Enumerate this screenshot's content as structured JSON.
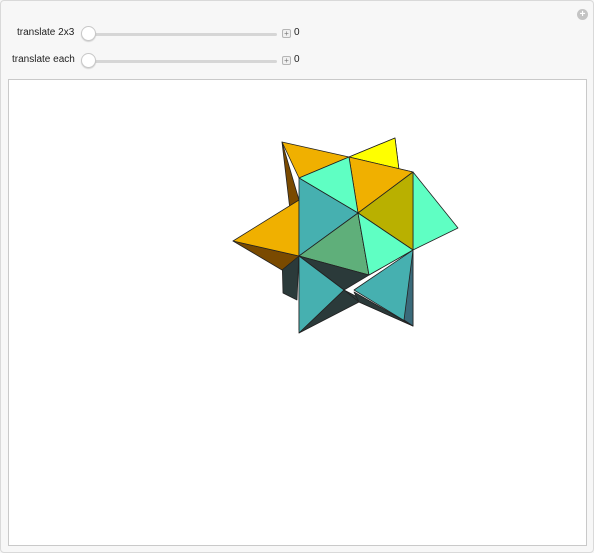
{
  "controls": [
    {
      "label": "translate 2x3",
      "value": "0",
      "level": 0
    },
    {
      "label": "translate each",
      "value": "0",
      "level": 0
    }
  ],
  "colors": {
    "orange": "#f0b000",
    "yellow": "#ffff00",
    "olive": "#b9b000",
    "aqua_light": "#5fffc3",
    "teal": "#46b0b0",
    "green": "#5faf7a",
    "dark": "#2b3a3a"
  }
}
